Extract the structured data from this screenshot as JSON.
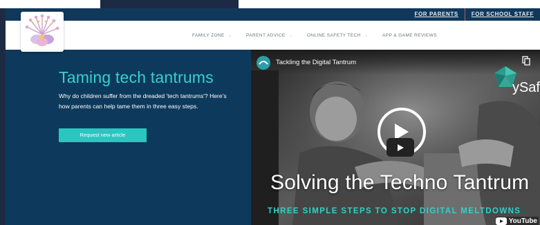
{
  "utility": {
    "links": [
      "FOR PARENTS",
      "FOR SCHOOL STAFF"
    ]
  },
  "nav": {
    "items": [
      {
        "label": "FAMILY ZONE",
        "icon": "chevron-down-icon"
      },
      {
        "label": "PARENT ADVICE",
        "icon": "chevron-down-icon"
      },
      {
        "label": "ONLINE SAFETY TECH",
        "icon": "chevron-down-icon"
      },
      {
        "label": "APP & GAME REVIEWS"
      }
    ]
  },
  "hero": {
    "title": "Taming tech tantrums",
    "description": "Why do children suffer from the dreaded 'tech tantrums'? Here's how parents can help tame them in three easy steps.",
    "cta_label": "Request new article"
  },
  "video": {
    "title": "Tackling the Digital Tantrum",
    "headline": "Solving the Techno Tantrum",
    "subheadline": "THREE SIMPLE STEPS TO STOP DIGITAL MELTDOWNS",
    "brand_partial": "ySaf",
    "youtube_label": "YouTube",
    "copy_link_label": "Copy link"
  },
  "colors": {
    "navy": "#0d3a5c",
    "teal": "#38cfd0",
    "cta": "#2ac7c0"
  }
}
